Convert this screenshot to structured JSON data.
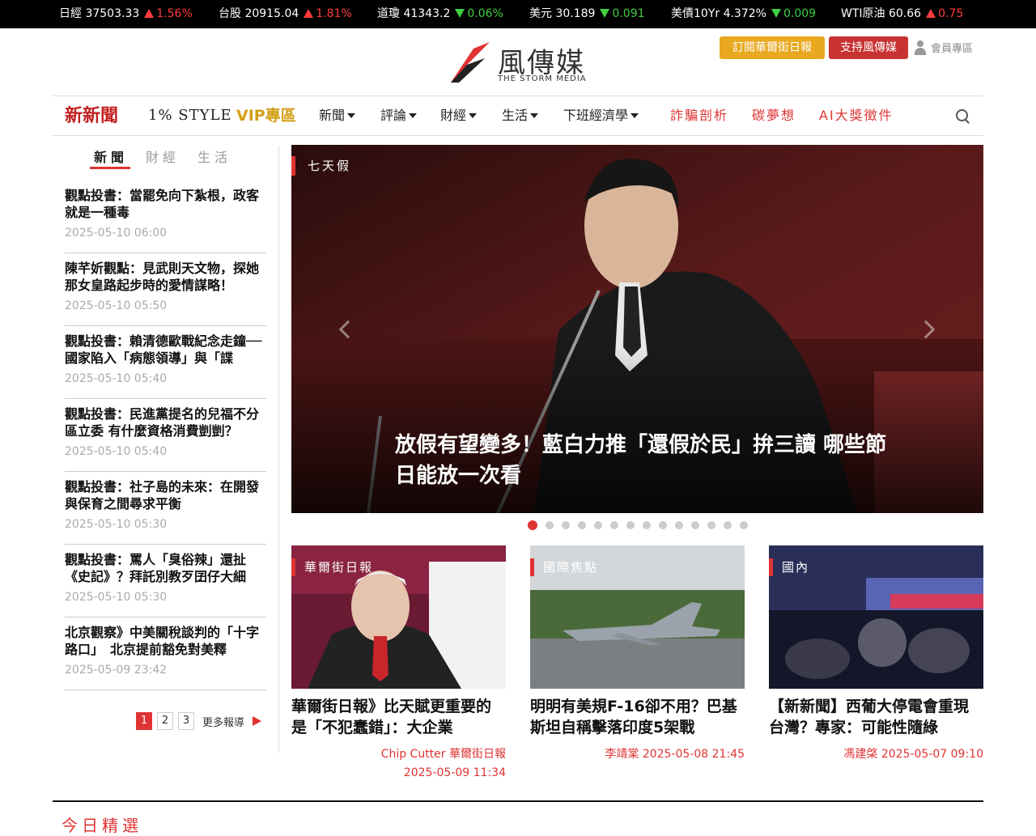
{
  "ticker": [
    {
      "name": "日經",
      "value": "37503.33",
      "change": "1.56%",
      "dir": "up"
    },
    {
      "name": "台股",
      "value": "20915.04",
      "change": "1.81%",
      "dir": "up"
    },
    {
      "name": "道瓊",
      "value": "41343.2",
      "change": "0.06%",
      "dir": "down"
    },
    {
      "name": "美元",
      "value": "30.189",
      "change": "0.091",
      "dir": "down"
    },
    {
      "name": "美債10Yr",
      "value": "4.372%",
      "change": "0.009",
      "dir": "down"
    },
    {
      "name": "WTI原油",
      "value": "60.66",
      "change": "0.75",
      "dir": "up"
    }
  ],
  "header": {
    "logo_cn": "風傳媒",
    "logo_en": "THE STORM MEDIA",
    "subscribe_label": "訂閱華爾街日報",
    "support_label": "支持風傳媒",
    "member_label": "會員專區"
  },
  "nav": {
    "brand1": "新新聞",
    "brand2": "1% STYLE",
    "vip": "VIP專區",
    "news": "新聞",
    "opinion": "評論",
    "finance": "財經",
    "life": "生活",
    "econ": "下班經濟學",
    "fraud": "詐騙剖析",
    "carbon": "碳夢想",
    "ai": "AI大獎徵件"
  },
  "side_tabs": {
    "news": "新聞",
    "finance": "財經",
    "life": "生活"
  },
  "side_items": [
    {
      "title": "觀點投書：當罷免向下紮根，政客就是一種毒",
      "date": "2025-05-10 06:00"
    },
    {
      "title": "陳芊妡觀點：見武則天文物，探她那女皇路起步時的愛情謀略！",
      "date": "2025-05-10 05:50"
    },
    {
      "title": "觀點投書：賴清德歐戰紀念走鐘──國家陷入「病態領導」與「諜",
      "date": "2025-05-10 05:40"
    },
    {
      "title": "觀點投書：民進黨提名的兒福不分區立委 有什麼資格消費剴剴？",
      "date": "2025-05-10 05:40"
    },
    {
      "title": "觀點投書：社子島的未來：在開發與保育之間尋求平衡",
      "date": "2025-05-10 05:30"
    },
    {
      "title": "觀點投書：罵人「臭俗辣」還扯《史記》？拜託別教歹囝仔大細",
      "date": "2025-05-10 05:30"
    },
    {
      "title": "北京觀察》中美關稅談判的「十字路口」　北京提前豁免對美釋",
      "date": "2025-05-09 23:42"
    }
  ],
  "pager": {
    "p1": "1",
    "p2": "2",
    "p3": "3",
    "more": "更多報導"
  },
  "hero": {
    "tag": "七天假",
    "title": "放假有望變多！藍白力推「還假於民」拚三讀 哪些節日能放一次看",
    "slides": 14,
    "active_slide": 1
  },
  "cards": [
    {
      "tag": "華爾街日報",
      "title": "華爾街日報》比天賦更重要的是「不犯蠢錯」：大企業",
      "author": "Chip Cutter  華爾街日報",
      "date": "2025-05-09 11:34"
    },
    {
      "tag": "國際焦點",
      "title": "明明有美規F-16卻不用？巴基斯坦自稱擊落印度5架戰",
      "author": "李靖棠 2025-05-08 21:45",
      "date": ""
    },
    {
      "tag": "國內",
      "title": "【新新聞】西葡大停電會重現台灣？專家：可能性隨綠",
      "author": "馮建棨 2025-05-07 09:10",
      "date": ""
    }
  ],
  "section": {
    "today": "今日精選"
  },
  "colors": {
    "accent": "#e03333",
    "gold": "#e8a820",
    "support": "#c83232",
    "ticker_bg": "#000000"
  }
}
